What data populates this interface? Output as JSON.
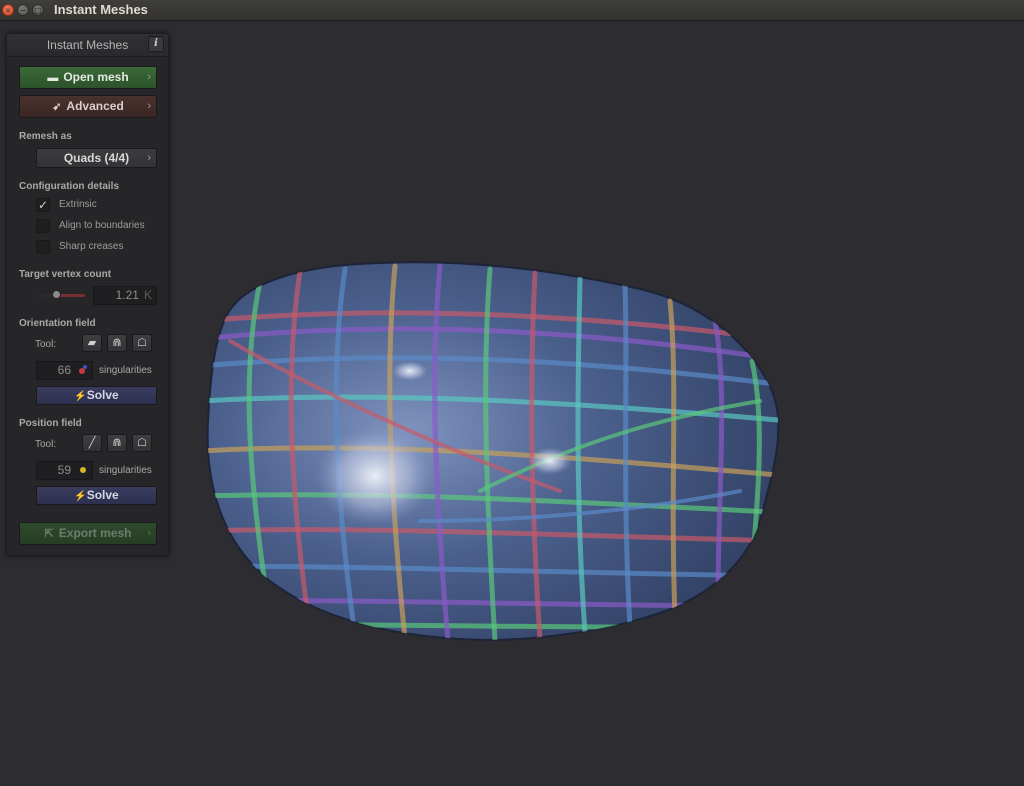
{
  "window": {
    "title": "Instant Meshes",
    "close_glyph": "×",
    "minimize_glyph": "−",
    "maximize_glyph": "□"
  },
  "panel": {
    "title": "Instant Meshes",
    "info_glyph": "i",
    "open_mesh": {
      "label": "Open mesh",
      "icon": "folder-icon",
      "glyph": "▬"
    },
    "advanced": {
      "label": "Advanced",
      "icon": "rocket-icon",
      "glyph": "➶"
    },
    "chevron": "›",
    "remesh_as": {
      "label": "Remesh as",
      "value": "Quads (4/4)"
    },
    "configuration": {
      "label": "Configuration details",
      "check_glyph": "✓",
      "options": [
        {
          "label": "Extrinsic",
          "checked": true
        },
        {
          "label": "Align to boundaries",
          "checked": false
        },
        {
          "label": "Sharp creases",
          "checked": false
        }
      ]
    },
    "target_vertex_count": {
      "label": "Target vertex count",
      "value": "1.21",
      "unit": "K",
      "slider_fraction": 0.4
    },
    "orientation_field": {
      "label": "Orientation field",
      "tool_label": "Tool:",
      "tools": [
        {
          "icon": "comb-icon",
          "glyph": "▰"
        },
        {
          "icon": "magnet-icon",
          "glyph": "⋒"
        },
        {
          "icon": "ghost-icon",
          "glyph": "☖"
        }
      ],
      "singularities_count": "66",
      "singularities_label": "singularities",
      "solve_label": "Solve",
      "solve_glyph": "⚡",
      "dot_colors": [
        "#c83a3a",
        "#3a52c8"
      ]
    },
    "position_field": {
      "label": "Position field",
      "tool_label": "Tool:",
      "tools": [
        {
          "icon": "line-icon",
          "glyph": "╱"
        },
        {
          "icon": "magnet-icon",
          "glyph": "⋒"
        },
        {
          "icon": "ghost-icon",
          "glyph": "☖"
        }
      ],
      "singularities_count": "59",
      "singularities_label": "singularities",
      "solve_label": "Solve",
      "solve_glyph": "⚡",
      "dot_color": "#d4b82a"
    },
    "export_mesh": {
      "label": "Export mesh",
      "icon": "export-icon",
      "glyph": "⇱"
    }
  },
  "colors": {
    "viewport_bg": "#2c2c31",
    "mesh_base": "#3a4d78",
    "stroke_colors": [
      "#c85a6a",
      "#5ac87a",
      "#5a8ac8",
      "#c8a05a",
      "#8a5ac8",
      "#5ac8c0"
    ]
  }
}
